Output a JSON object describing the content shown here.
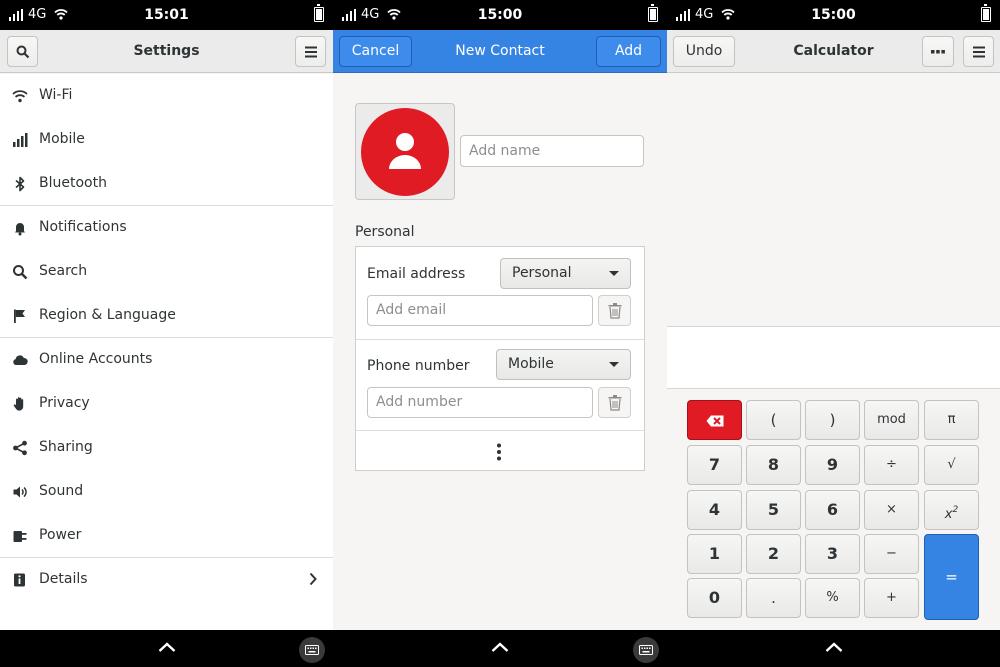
{
  "status": {
    "network": "4G",
    "times": [
      "15:01",
      "15:00",
      "15:00"
    ]
  },
  "settings": {
    "title": "Settings",
    "items": [
      {
        "label": "Wi-Fi",
        "icon": "wifi-icon"
      },
      {
        "label": "Mobile",
        "icon": "cellular-icon"
      },
      {
        "label": "Bluetooth",
        "icon": "bluetooth-icon"
      },
      {
        "label": "Notifications",
        "icon": "bell-icon"
      },
      {
        "label": "Search",
        "icon": "search-icon"
      },
      {
        "label": "Region & Language",
        "icon": "flag-icon"
      },
      {
        "label": "Online Accounts",
        "icon": "cloud-icon"
      },
      {
        "label": "Privacy",
        "icon": "hand-icon"
      },
      {
        "label": "Sharing",
        "icon": "share-icon"
      },
      {
        "label": "Sound",
        "icon": "speaker-icon"
      },
      {
        "label": "Power",
        "icon": "power-plug-icon"
      },
      {
        "label": "Details",
        "icon": "info-icon"
      }
    ]
  },
  "contact": {
    "cancel_label": "Cancel",
    "title": "New Contact",
    "add_label": "Add",
    "name_placeholder": "Add name",
    "section_label": "Personal",
    "email_label": "Email address",
    "email_type": "Personal",
    "email_placeholder": "Add email",
    "phone_label": "Phone number",
    "phone_type": "Mobile",
    "phone_placeholder": "Add number",
    "accent_color": "#3584e4",
    "avatar_color": "#e01b24"
  },
  "calculator": {
    "title": "Calculator",
    "undo_label": "Undo",
    "keys": {
      "open_paren": "(",
      "close_paren": ")",
      "mod": "mod",
      "pi": "π",
      "k7": "7",
      "k8": "8",
      "k9": "9",
      "divide": "÷",
      "sqrt": "√",
      "k4": "4",
      "k5": "5",
      "k6": "6",
      "multiply": "×",
      "x_base": "x",
      "x_exp": "2",
      "k1": "1",
      "k2": "2",
      "k3": "3",
      "minus": "−",
      "k0": "0",
      "decimal": ".",
      "percent": "%",
      "plus": "+",
      "equals": "="
    },
    "equals_color": "#3584e4",
    "backspace_color": "#e01b24"
  }
}
